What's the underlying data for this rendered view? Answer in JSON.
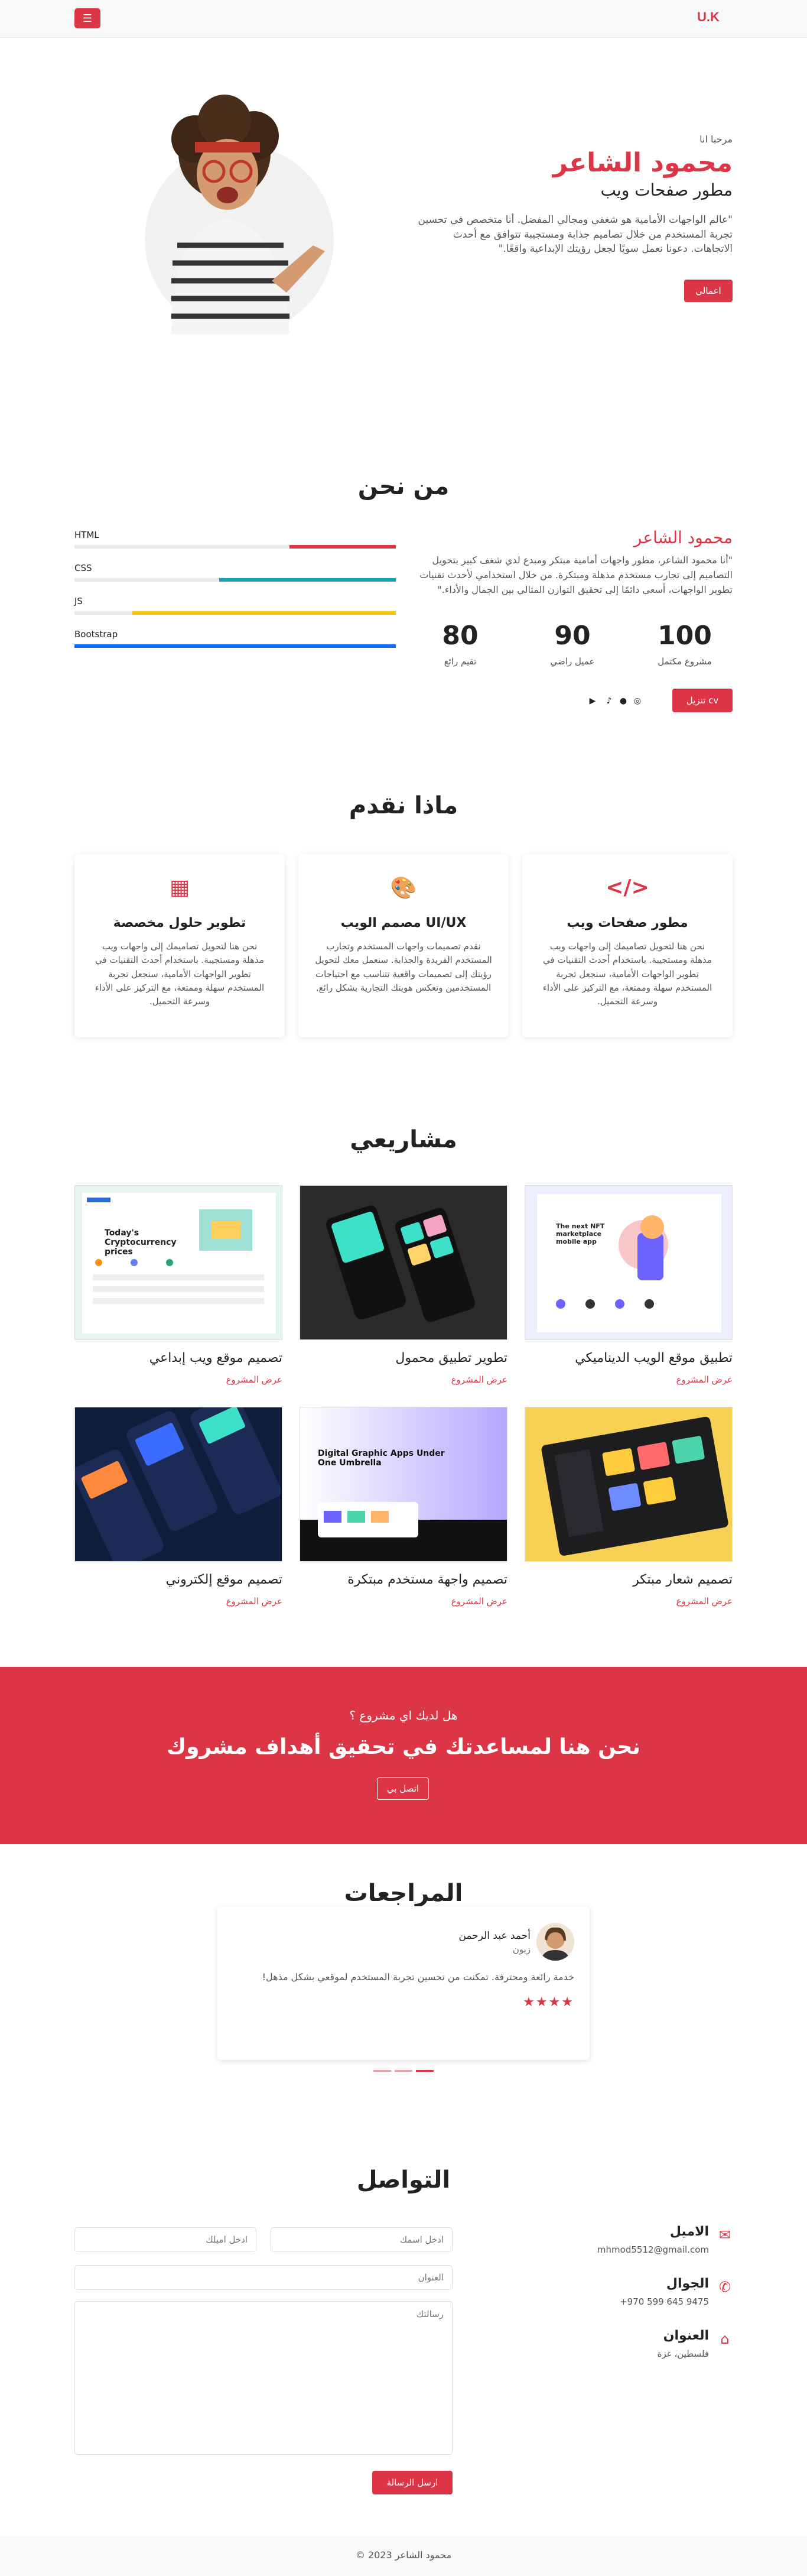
{
  "navbar": {
    "brand": "U.K",
    "menu_icon": "☰"
  },
  "hero": {
    "greeting": "مرحبا انا",
    "name": "محمود الشاعر",
    "role": "مطور صفحات ويب",
    "description": "\"عالم الواجهات الأمامية هو شغفي ومجالي المفضل. أنا متخصص في تحسين تجربة المستخدم من خلال تصاميم جذابة ومستجيبة تتوافق مع أحدث الاتجاهات. دعونا نعمل سويًا لجعل رؤيتك الإبداعية واقعًا.\"",
    "button": "اعمالي"
  },
  "about": {
    "title": "من نحن",
    "name": "محمود الشاعر",
    "description": "\"أنا محمود الشاعر، مطور واجهات أمامية مبتكر ومبدع لدي شغف كبير بتحويل التصاميم إلى تجارب مستخدم مذهلة ومبتكرة. من خلال استخدامي لأحدث تقنيات تطوير الواجهات، أسعى دائمًا إلى تحقيق التوازن المثالي بين الجمال والأداء.\"",
    "stats": [
      {
        "value": "100",
        "label": "مشروع مكتمل"
      },
      {
        "value": "90",
        "label": "عميل راضي"
      },
      {
        "value": "80",
        "label": "تقيم رائع"
      }
    ],
    "cv_button": "تنزيل cv",
    "skills": [
      {
        "name": "HTML",
        "percent": 33,
        "color": "#dc3545"
      },
      {
        "name": "CSS",
        "percent": 55,
        "color": "#17a2b8"
      },
      {
        "name": "JS",
        "percent": 82,
        "color": "#ffc107"
      },
      {
        "name": "Bootstrap",
        "percent": 100,
        "color": "#0d6efd"
      }
    ]
  },
  "services": {
    "title": "ماذا نقدم",
    "items": [
      {
        "icon": "</>",
        "title": "مطور صفحات ويب",
        "desc": "نحن هنا لتحويل تصاميمك إلى واجهات ويب مذهلة ومستجيبة. باستخدام أحدث التقنيات في تطوير الواجهات الأمامية، سنجعل تجربة المستخدم سهلة وممتعة، مع التركيز على الأداء وسرعة التحميل."
      },
      {
        "icon": "🎨",
        "title": "مصمم الويب UI/UX",
        "desc": "نقدم تصميمات واجهات المستخدم وتجارب المستخدم الفريدة والجذابة. سنعمل معك لتحويل رؤيتك إلى تصميمات واقعية تتناسب مع احتياجات المستخدمين وتعكس هويتك التجارية بشكل رائع."
      },
      {
        "icon": "▦",
        "title": "تطوير حلول مخصصة",
        "desc": "نحن هنا لتحويل تصاميمك إلى واجهات ويب مذهلة ومستجيبة. باستخدام أحدث التقنيات في تطوير الواجهات الأمامية، سنجعل تجربة المستخدم سهلة وممتعة، مع التركيز على الأداء وسرعة التحميل."
      }
    ]
  },
  "projects": {
    "title": "مشاريعي",
    "link_label": "عرض المشروع",
    "items": [
      {
        "title": "تطبيق موقع الويب الديناميكي",
        "mock_heading": "The next NFT marketplace mobile app"
      },
      {
        "title": "تطوير تطبيق محمول",
        "mock_heading": ""
      },
      {
        "title": "تصميم موقع ويب إبداعي",
        "mock_heading": "Today's Cryptocurrency prices"
      },
      {
        "title": "تصميم شعار مبتكر",
        "mock_heading": ""
      },
      {
        "title": "تصميم واجهة مستخدم مبتكرة",
        "mock_heading": "Digital Graphic Apps Under One Umbrella"
      },
      {
        "title": "تصميم موقع إلكتروني",
        "mock_heading": ""
      }
    ]
  },
  "cta": {
    "question": "هل لديك اي مشروع ؟",
    "headline": "نحن هنا لمساعدتك في تحقيق أهداف مشروك",
    "button": "اتصل بي"
  },
  "testimonials": {
    "title": "المراجعات",
    "name": "أحمد عبد الرحمن",
    "company": "زبون",
    "quote": "خدمة رائعة ومحترفة. تمكنت من تحسين تجربة المستخدم لموقعي بشكل مذهل!",
    "stars": "★★★★",
    "rating": 4
  },
  "contact": {
    "title": "التواصل",
    "name_placeholder": "ادخل اسمك",
    "email_placeholder": "ادخل اميلك",
    "subject_placeholder": "العنوان",
    "message_placeholder": "رسالتك",
    "send_button": "ارسل الرسالة",
    "info": [
      {
        "icon": "envelope-icon",
        "title": "الاميل",
        "value": "mhmod5512@gmail.com"
      },
      {
        "icon": "phone-icon",
        "title": "الجوال",
        "value": "+970 599 645 9475"
      },
      {
        "icon": "map-icon",
        "title": "العنوان",
        "value": "فلسطين، غزة"
      }
    ]
  },
  "footer": {
    "text": "© 2023 محمود الشاعر"
  }
}
